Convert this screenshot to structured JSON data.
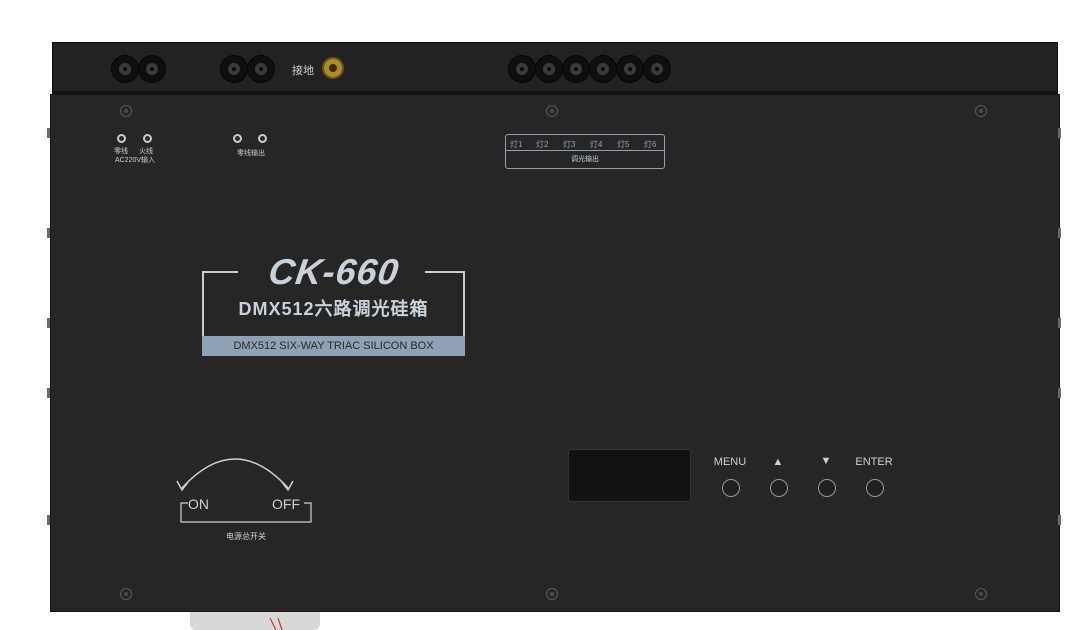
{
  "device": {
    "model": "CK-660",
    "name_cn": "DMX512六路调光硅箱",
    "name_en": "DMX512 SIX-WAY TRIAC SILICON BOX"
  },
  "top_strip": {
    "ground_label": "接地"
  },
  "terminals": {
    "input": {
      "neutral": "零线",
      "live": "火线",
      "caption": "AC220V输入"
    },
    "neutral_output": "零线输出"
  },
  "dimming_output": {
    "lamps": [
      "灯1",
      "灯2",
      "灯3",
      "灯4",
      "灯5",
      "灯6"
    ],
    "caption": "调光输出"
  },
  "power_switch": {
    "on": "ON",
    "off": "OFF",
    "caption": "电源总开关"
  },
  "controls": {
    "menu": "MENU",
    "up": "▲",
    "down": "▼",
    "enter": "ENTER"
  },
  "colors": {
    "panel": "#262626",
    "label_accent": "#8ea1b5",
    "ground_terminal": "#b08b2e"
  }
}
